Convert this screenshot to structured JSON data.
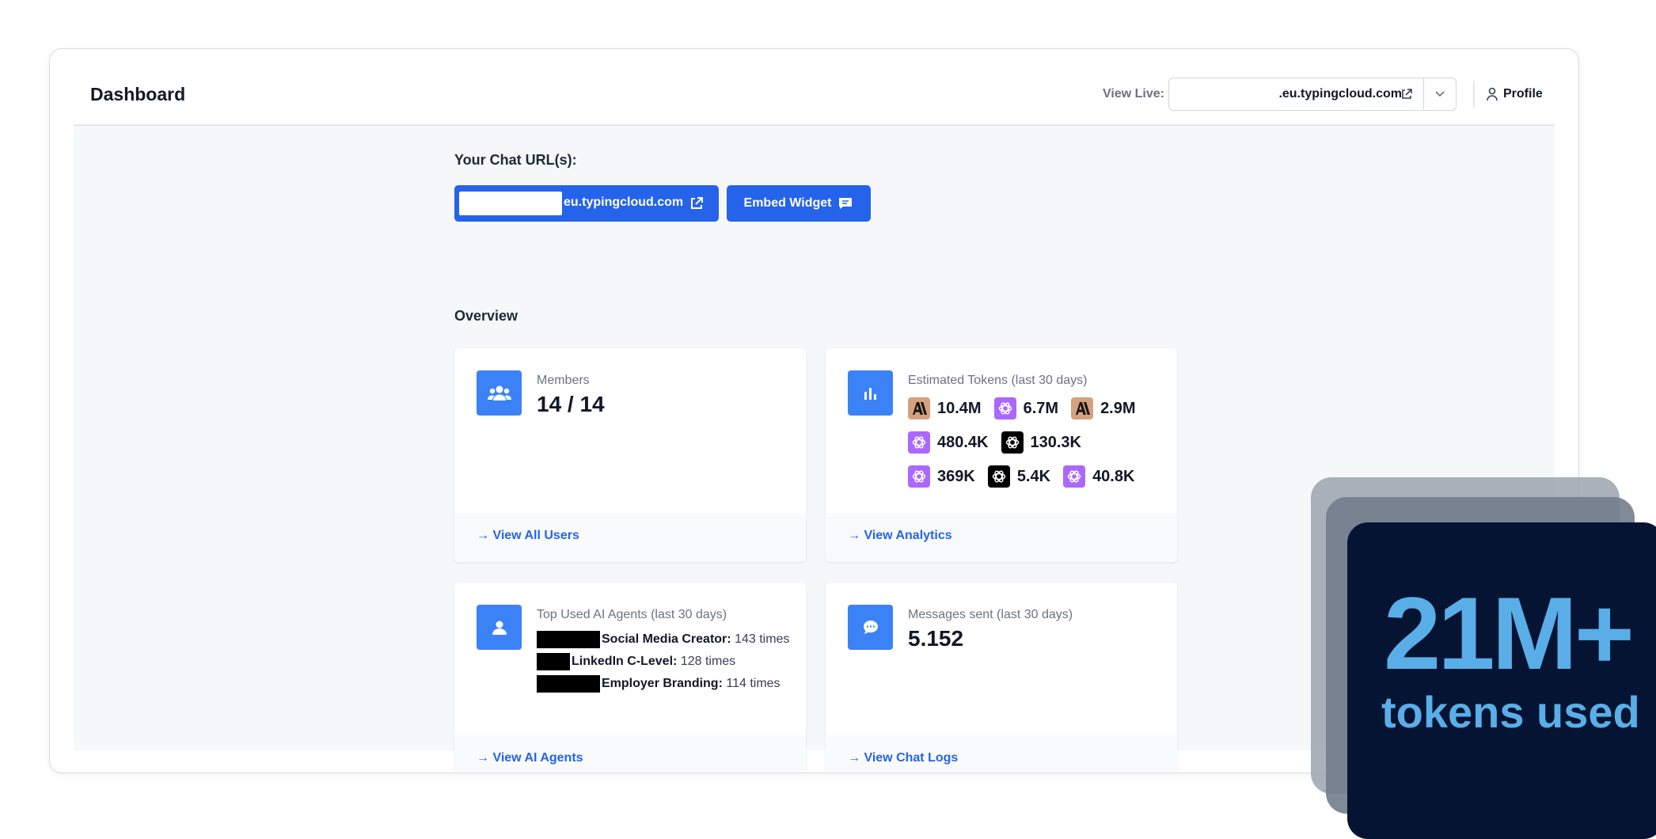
{
  "header": {
    "title": "Dashboard",
    "view_live_label": "View Live:",
    "view_live_value": ".eu.typingcloud.com",
    "profile_label": "Profile"
  },
  "chat_urls": {
    "label": "Your Chat URL(s):",
    "url_button": "eu.typingcloud.com",
    "embed_button": "Embed Widget"
  },
  "overview": {
    "label": "Overview",
    "members": {
      "label": "Members",
      "value": "14 / 14",
      "link": "→ View All Users"
    },
    "tokens": {
      "label": "Estimated Tokens (last 30 days)",
      "rows": [
        [
          {
            "provider": "anthropic",
            "value": "10.4M"
          },
          {
            "provider": "openai-purple",
            "value": "6.7M"
          },
          {
            "provider": "anthropic",
            "value": "2.9M"
          }
        ],
        [
          {
            "provider": "openai-purple",
            "value": "480.4K"
          },
          {
            "provider": "openai-black",
            "value": "130.3K"
          }
        ],
        [
          {
            "provider": "openai-purple",
            "value": "369K"
          },
          {
            "provider": "openai-black",
            "value": "5.4K"
          },
          {
            "provider": "openai-purple",
            "value": "40.8K"
          }
        ]
      ],
      "link": "→ View Analytics"
    },
    "agents": {
      "label": "Top Used AI Agents (last 30 days)",
      "items": [
        {
          "name": "Social Media Creator:",
          "count": "143 times"
        },
        {
          "name": "LinkedIn C-Level:",
          "count": "128 times"
        },
        {
          "name": "Employer Branding:",
          "count": "114 times"
        }
      ],
      "link": "→ View AI Agents"
    },
    "messages": {
      "label": "Messages sent (last 30 days)",
      "value": "5.152",
      "link": "→ View Chat Logs"
    }
  },
  "badge": {
    "number": "21M+",
    "caption": "tokens used"
  },
  "colors": {
    "primary": "#2563eb",
    "icon_bg": "#3b82f6",
    "badge_bg": "#061433",
    "badge_text": "#5aaee8"
  }
}
